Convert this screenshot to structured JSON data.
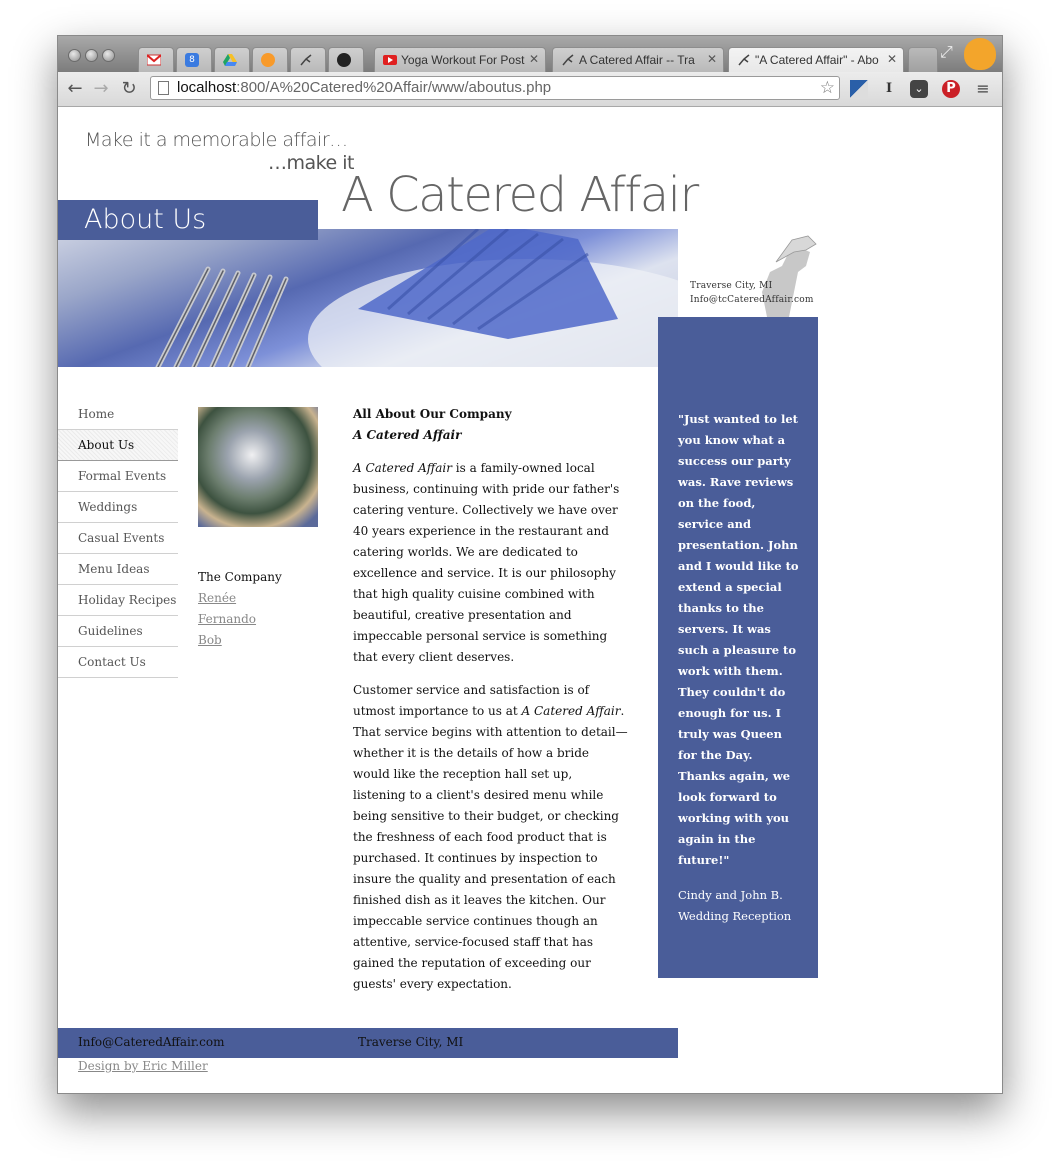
{
  "browser": {
    "tabs": [
      {
        "label": "",
        "icon": "gmail-icon"
      },
      {
        "label": "",
        "icon": "calendar-icon"
      },
      {
        "label": "",
        "icon": "drive-icon"
      },
      {
        "label": "",
        "icon": "orange-app-icon"
      },
      {
        "label": "",
        "icon": "catered-affair-logo-icon"
      },
      {
        "label": "",
        "icon": "github-icon"
      },
      {
        "label": "Yoga Workout For Post",
        "icon": "youtube-icon"
      },
      {
        "label": "A Catered Affair -- Tra",
        "icon": "catered-affair-logo-icon"
      },
      {
        "label": "\"A Catered Affair\" - Abo",
        "icon": "catered-affair-logo-icon",
        "active": true
      }
    ],
    "url_host": "localhost",
    "url_rest": ":800/A%20Catered%20Affair/www/aboutus.php",
    "calendar_badge": "8"
  },
  "header": {
    "tagline_1": "Make it a memorable affair…",
    "tagline_2": "…make it",
    "brand": "A Catered Affair",
    "page_title": "About Us",
    "location": "Traverse City, MI",
    "email": "Info@tcCateredAffair.com"
  },
  "nav": {
    "items": [
      "Home",
      "About Us",
      "Formal Events",
      "Weddings",
      "Casual Events",
      "Menu Ideas",
      "Holiday Recipes",
      "Guidelines",
      "Contact Us"
    ],
    "active": "About Us"
  },
  "subnav": {
    "heading": "The Company",
    "links": [
      "Renée",
      "Fernando",
      "Bob"
    ]
  },
  "content": {
    "heading": "All About Our Company",
    "subheading": "A Catered Affair",
    "p1_em": "A Catered Affair",
    "p1_rest": " is a family-owned local business, continuing with pride our father's catering venture. Collectively we have over 40 years experience in the restaurant and catering worlds. We are dedicated to excellence and service. It is our philosophy that high quality cuisine combined with beautiful, creative presentation and impeccable personal service is something that every client deserves.",
    "p2_start": "Customer service and satisfaction is of utmost importance to us at ",
    "p2_em": "A Catered Affair",
    "p2_rest": ". That service begins with attention to detail— whether it is the details of how a bride would like the reception hall set up, listening to a client's desired menu while being sensitive to their budget, or checking the freshness of each food product that is purchased. It continues by inspection to insure the quality and presentation of each finished dish as it leaves the kitchen. Our impeccable service continues though an attentive, service-focused staff that has gained the reputation of exceeding our guests' every expectation."
  },
  "testimonial": {
    "quote": "\"Just wanted to let you know what a success our party was. Rave reviews on the food, service and presentation. John and I would like to extend a special thanks to the servers. It was such a pleasure to work with them. They couldn't do enough for us. I truly was Queen for the Day. Thanks again, we look forward to working with you again in the future!\"",
    "author": "Cindy and John B.",
    "event": "Wedding Reception"
  },
  "footer": {
    "email": "Info@CateredAffair.com",
    "city": "Traverse City, MI",
    "credit": "Design by Eric Miller"
  },
  "colors": {
    "accent_blue": "#4a5d99",
    "nav_text": "#555555",
    "link_gray": "#888888"
  }
}
